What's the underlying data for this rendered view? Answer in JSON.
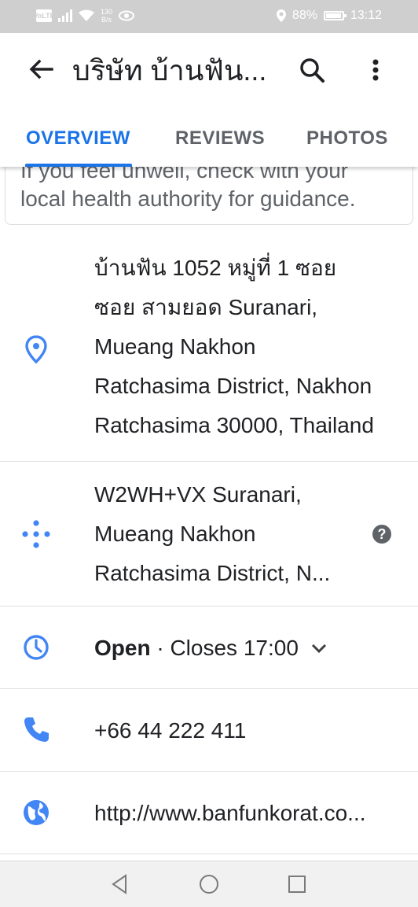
{
  "status_bar": {
    "network_badge": "VoLTE",
    "speed_value": "130",
    "speed_unit": "B/s",
    "battery": "88%",
    "battery_level": 0.88,
    "time": "13:12"
  },
  "app_bar": {
    "title": "บริษัท บ้านฟัน..."
  },
  "tabs": [
    {
      "label": "OVERVIEW",
      "active": true
    },
    {
      "label": "REVIEWS",
      "active": false
    },
    {
      "label": "PHOTOS",
      "active": false
    }
  ],
  "notice": {
    "line1": "If you feel unwell, check with your",
    "line2": "local health authority for guidance."
  },
  "address": {
    "lines": [
      "บ้านฟัน 1052 หมู่ที่ 1 ซอย",
      "ซอย สามยอด Suranari,",
      "Mueang Nakhon",
      "Ratchasima District, Nakhon",
      "Ratchasima 30000, Thailand"
    ]
  },
  "plus_code": {
    "lines": [
      "W2WH+VX Suranari,",
      "Mueang Nakhon",
      "Ratchasima District, N..."
    ],
    "help_label": "?"
  },
  "hours": {
    "status": "Open",
    "separator": " · ",
    "closes": "Closes 17:00"
  },
  "phone": "+66 44 222 411",
  "website": "http://www.banfunkorat.co...",
  "colors": {
    "accent": "#1a73e8",
    "icon_blue": "#4285f4",
    "muted": "#5f6368"
  }
}
